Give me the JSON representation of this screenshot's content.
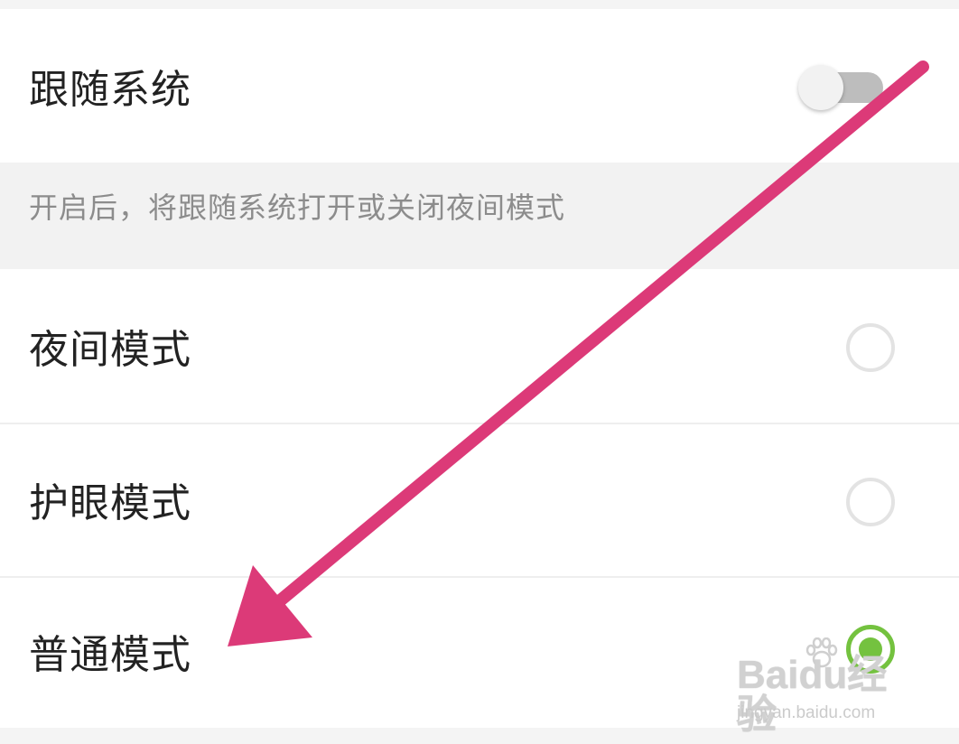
{
  "follow_system": {
    "label": "跟随系统",
    "enabled": false
  },
  "hint": "开启后，将跟随系统打开或关闭夜间模式",
  "modes": [
    {
      "label": "夜间模式",
      "selected": false
    },
    {
      "label": "护眼模式",
      "selected": false
    },
    {
      "label": "普通模式",
      "selected": true
    }
  ],
  "colors": {
    "accent_green": "#74c23f",
    "arrow_pink": "#dc3a78",
    "toggle_track_off": "#bdbdbd"
  },
  "watermark": {
    "logo": "Baidu经验",
    "url": "jingyan.baidu.com"
  }
}
